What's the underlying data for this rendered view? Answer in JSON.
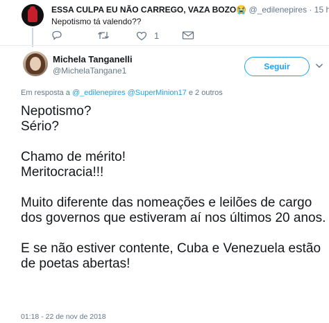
{
  "prev_tweet": {
    "display_name": "ESSA CULPA EU NÃO CARREGO, VAZA BOZO",
    "emoji": "😭",
    "handle": "@_edilenepires",
    "dot": "·",
    "time": "15 h",
    "text": "Nepotismo tá valendo??",
    "actions": {
      "reply_icon": "reply-icon",
      "retweet_icon": "retweet-icon",
      "like_icon": "heart-icon",
      "like_count": "1",
      "dm_icon": "envelope-icon"
    }
  },
  "main_tweet": {
    "display_name": "Michela Tanganelli",
    "handle": "@MichelaTangane1",
    "follow_label": "Seguir",
    "menu_icon": "chevron-down-icon",
    "reply_prefix": "Em resposta a",
    "reply_to": "@_edilenepires @SuperMinion17",
    "reply_suffix": "e 2 outros",
    "text": "Nepotismo?\nSério?\n\nChamo de mérito!\nMeritocracia!!!\n\nMuito diferente das nomeações e leilões de cargo dos governos que estiveram aí nos últimos 20 anos.\n\nE se não estiver contente, Cuba e Venezuela estão de poetas abertas!",
    "timestamp": "01:18 - 22 de nov de 2018"
  },
  "colors": {
    "accent": "#1da1f2",
    "muted": "#657786",
    "text": "#14171a"
  }
}
